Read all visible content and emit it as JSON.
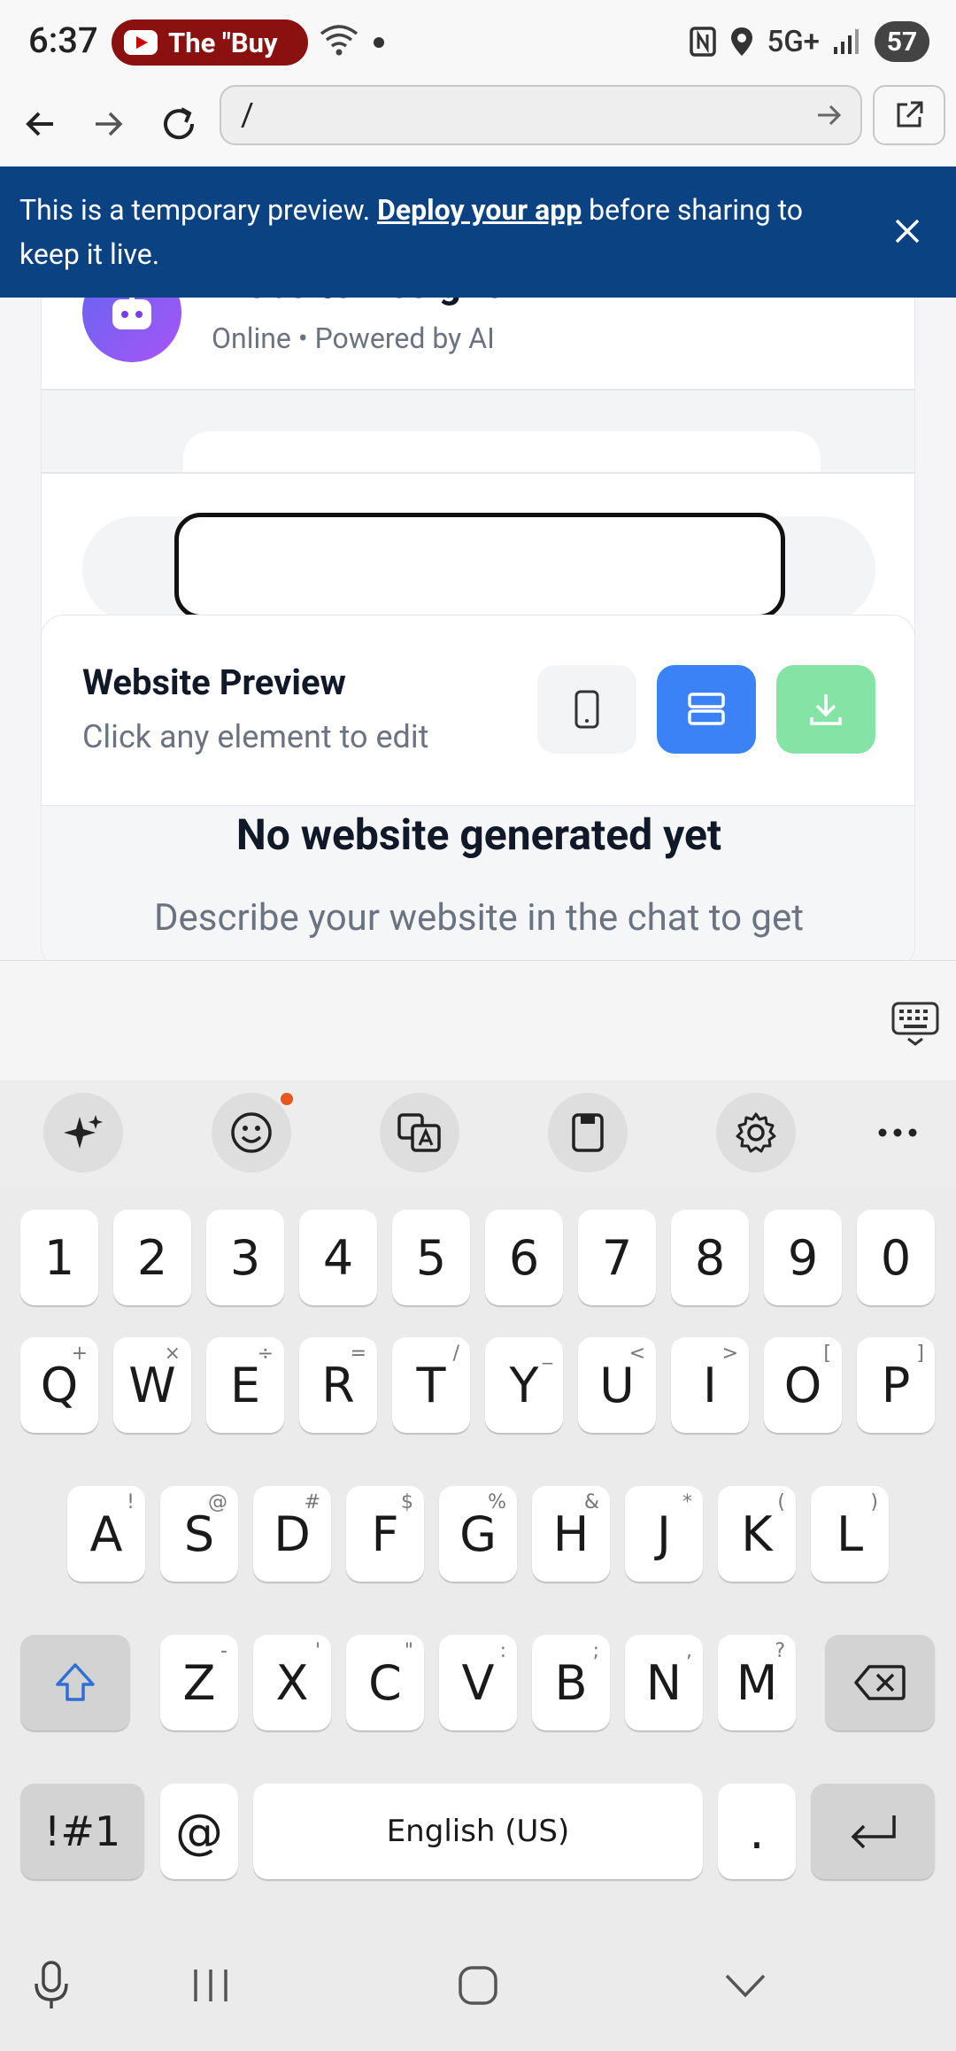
{
  "status_bar": {
    "time": "6:37",
    "notification": "The \"Buy",
    "network": "5G+",
    "battery": "57"
  },
  "browser": {
    "url": "/"
  },
  "banner": {
    "text_before": "This is a temporary preview. ",
    "link": "Deploy your app",
    "text_after": " before sharing to keep it live."
  },
  "chat_card": {
    "title": "Website Designer",
    "subtitle": "Online • Powered by AI"
  },
  "preview": {
    "title": "Website Preview",
    "subtitle": "Click any element to edit",
    "empty_title": "No website generated yet",
    "empty_desc": "Describe your website in the chat to get"
  },
  "keyboard": {
    "numbers": [
      "1",
      "2",
      "3",
      "4",
      "5",
      "6",
      "7",
      "8",
      "9",
      "0"
    ],
    "row1": [
      [
        "Q",
        "+"
      ],
      [
        "W",
        "×"
      ],
      [
        "E",
        "÷"
      ],
      [
        "R",
        "="
      ],
      [
        "T",
        "/"
      ],
      [
        "Y",
        "_"
      ],
      [
        "U",
        "<"
      ],
      [
        "I",
        ">"
      ],
      [
        "O",
        "["
      ],
      [
        "P",
        "]"
      ]
    ],
    "row2": [
      [
        "A",
        "!"
      ],
      [
        "S",
        "@"
      ],
      [
        "D",
        "#"
      ],
      [
        "F",
        "$"
      ],
      [
        "G",
        "%"
      ],
      [
        "H",
        "&"
      ],
      [
        "J",
        "*"
      ],
      [
        "K",
        "("
      ],
      [
        "L",
        ")"
      ]
    ],
    "row3": [
      [
        "Z",
        "-"
      ],
      [
        "X",
        "'"
      ],
      [
        "C",
        "\""
      ],
      [
        "V",
        ":"
      ],
      [
        "B",
        ";"
      ],
      [
        "N",
        ","
      ],
      [
        "M",
        "?"
      ]
    ],
    "symbols_label": "!#1",
    "at_label": "@",
    "space_label": "English (US)",
    "period_label": "."
  },
  "colors": {
    "banner": "#0b4282",
    "accent_blue": "#3b82f6",
    "download_green": "#86e3a6"
  }
}
